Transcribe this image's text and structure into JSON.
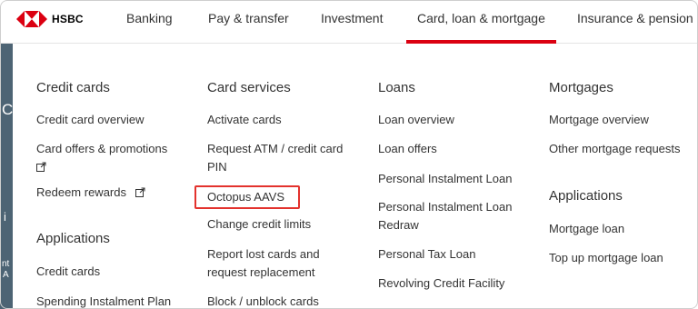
{
  "brand": {
    "name": "HSBC",
    "accent": "#db0011"
  },
  "nav": {
    "items": [
      {
        "label": "Banking"
      },
      {
        "label": "Pay & transfer"
      },
      {
        "label": "Investment"
      },
      {
        "label": "Card, loan & mortgage"
      },
      {
        "label": "Insurance & pension"
      }
    ],
    "active_index": 3
  },
  "strip_chars": [
    "C",
    "i",
    "nt",
    "A"
  ],
  "menu": {
    "credit_cards": {
      "title": "Credit cards",
      "links": [
        "Credit card overview",
        "Card offers & promotions",
        "Redeem rewards"
      ],
      "applications_title": "Applications",
      "applications_links": [
        "Credit cards",
        "Spending Instalment Plan"
      ]
    },
    "card_services": {
      "title": "Card services",
      "links": [
        "Activate cards",
        "Request ATM / credit card",
        "PIN",
        "Octopus AAVS",
        "Change credit limits",
        "Report lost cards and",
        "request replacement",
        "Block / unblock cards"
      ]
    },
    "loans": {
      "title": "Loans",
      "links": [
        "Loan overview",
        "Loan offers",
        "Personal Instalment Loan",
        "Personal Instalment Loan",
        "Redraw",
        "Personal Tax Loan",
        "Revolving Credit Facility"
      ]
    },
    "mortgages": {
      "title": "Mortgages",
      "links": [
        "Mortgage overview",
        "Other mortgage requests"
      ],
      "applications_title": "Applications",
      "applications_links": [
        "Mortgage loan",
        "Top up mortgage loan"
      ]
    }
  },
  "highlight_color": "#e3322d"
}
